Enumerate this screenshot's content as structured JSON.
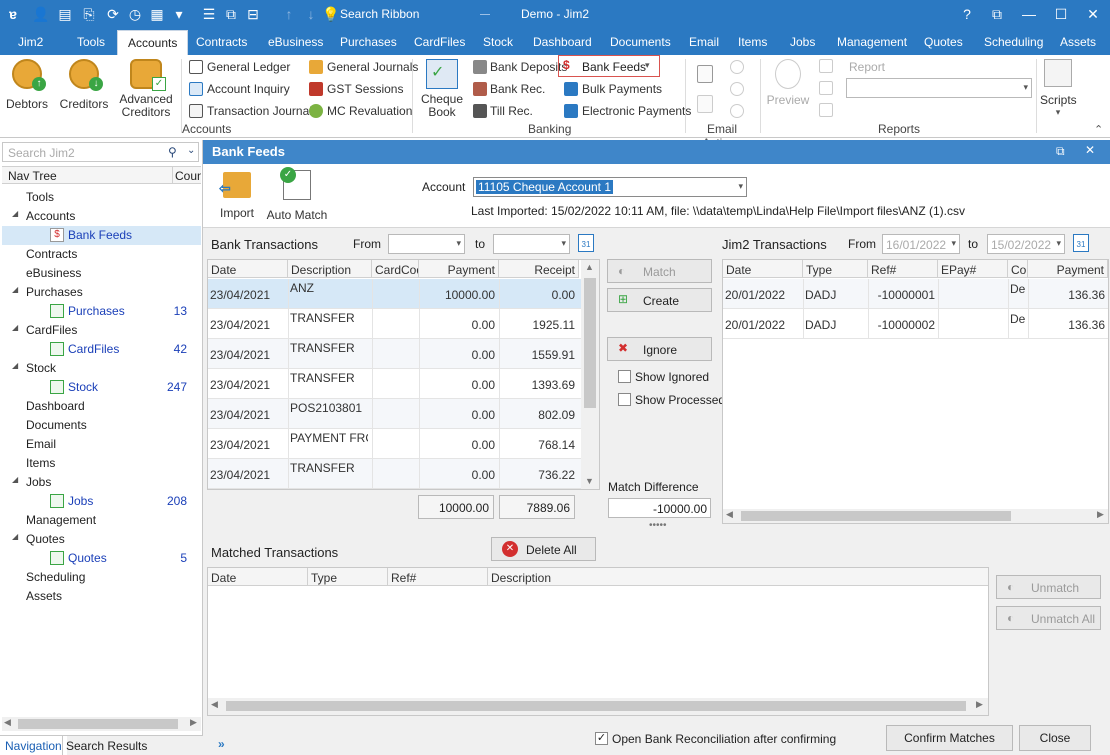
{
  "title": "Demo - Jim2",
  "quick_access": {
    "search_ribbon": "Search Ribbon"
  },
  "window_controls": {
    "help": "?",
    "restore": "⧉",
    "minimize": "—",
    "maximize": "☐",
    "close": "✕"
  },
  "menu_tabs": [
    "Jim2",
    "Tools",
    "Accounts",
    "Contracts",
    "eBusiness",
    "Purchases",
    "CardFiles",
    "Stock",
    "Dashboard",
    "Documents",
    "Email",
    "Items",
    "Jobs",
    "Management",
    "Quotes",
    "Scheduling",
    "Assets"
  ],
  "active_tab": "Accounts",
  "ribbon": {
    "debtors": "Debtors",
    "creditors": "Creditors",
    "advanced_creditors_1": "Advanced",
    "advanced_creditors_2": "Creditors",
    "general_ledger": "General Ledger",
    "account_inquiry": "Account Inquiry",
    "transaction_journal": "Transaction Journal",
    "general_journals": "General Journals",
    "gst_sessions": "GST Sessions",
    "mc_revaluation": "MC Revaluation",
    "accounts_group": "Accounts",
    "cheque_book_1": "Cheque",
    "cheque_book_2": "Book",
    "bank_deposits": "Bank Deposits",
    "bank_rec": "Bank Rec.",
    "till_rec": "Till Rec.",
    "bank_feeds": "Bank Feeds",
    "bulk_payments": "Bulk Payments",
    "electronic_payments": "Electronic Payments",
    "banking_group": "Banking",
    "email_actions_group": "Email Actions",
    "preview": "Preview",
    "report_label": "Report",
    "reports_group": "Reports",
    "scripts": "Scripts"
  },
  "nav": {
    "search_placeholder": "Search Jim2",
    "col_tree": "Nav Tree",
    "col_count": "Count",
    "items": [
      {
        "label": "Tools"
      },
      {
        "label": "Accounts"
      },
      {
        "label": "Bank Feeds",
        "sub": true
      },
      {
        "label": "Contracts"
      },
      {
        "label": "eBusiness"
      },
      {
        "label": "Purchases"
      },
      {
        "label": "Purchases",
        "sub": true,
        "count": "13"
      },
      {
        "label": "CardFiles"
      },
      {
        "label": "CardFiles",
        "sub": true,
        "count": "42"
      },
      {
        "label": "Stock"
      },
      {
        "label": "Stock",
        "sub": true,
        "count": "247"
      },
      {
        "label": "Dashboard"
      },
      {
        "label": "Documents"
      },
      {
        "label": "Email"
      },
      {
        "label": "Items"
      },
      {
        "label": "Jobs"
      },
      {
        "label": "Jobs",
        "sub": true,
        "count": "208"
      },
      {
        "label": "Management"
      },
      {
        "label": "Quotes"
      },
      {
        "label": "Quotes",
        "sub": true,
        "count": "5"
      },
      {
        "label": "Scheduling"
      },
      {
        "label": "Assets"
      }
    ],
    "tab_navigation": "Navigation",
    "tab_search_results": "Search Results"
  },
  "panel": {
    "title": "Bank Feeds",
    "import": "Import",
    "auto_match": "Auto Match",
    "account_label": "Account",
    "account_value": "11105 Cheque Account 1",
    "last_imported": "Last Imported: 15/02/2022 10:11 AM, file: \\\\data\\temp\\Linda\\Help File\\Import files\\ANZ (1).csv",
    "bank_transactions": "Bank Transactions",
    "from": "From",
    "to": "to",
    "bank_cols": [
      "Date",
      "Description",
      "CardCod",
      "Payment",
      "Receipt"
    ],
    "bank_rows": [
      [
        "23/04/2021",
        "ANZ",
        "",
        "10000.00",
        "0.00"
      ],
      [
        "23/04/2021",
        "TRANSFER",
        "",
        "0.00",
        "1925.11"
      ],
      [
        "23/04/2021",
        "TRANSFER",
        "",
        "0.00",
        "1559.91"
      ],
      [
        "23/04/2021",
        "TRANSFER",
        "",
        "0.00",
        "1393.69"
      ],
      [
        "23/04/2021",
        "POS2103801",
        "",
        "0.00",
        "802.09"
      ],
      [
        "23/04/2021",
        "PAYMENT FROM",
        "",
        "0.00",
        "768.14"
      ],
      [
        "23/04/2021",
        "TRANSFER",
        "",
        "0.00",
        "736.22"
      ]
    ],
    "bank_total_payment": "10000.00",
    "bank_total_receipt": "7889.06",
    "match": "Match",
    "create": "Create",
    "ignore": "Ignore",
    "show_ignored": "Show Ignored",
    "show_processed": "Show Processed",
    "match_difference_label": "Match Difference",
    "match_difference": "-10000.00",
    "jim2_transactions": "Jim2 Transactions",
    "jim2_from": "16/01/2022",
    "jim2_to": "15/02/2022",
    "jim2_cols": [
      "Date",
      "Type",
      "Ref#",
      "EPay#",
      "Cor",
      "Payment"
    ],
    "jim2_rows": [
      [
        "20/01/2022",
        "DADJ",
        "-10000001",
        "",
        "De",
        "136.36"
      ],
      [
        "20/01/2022",
        "DADJ",
        "-10000002",
        "",
        "De",
        "136.36"
      ]
    ],
    "matched_transactions": "Matched Transactions",
    "delete_all": "Delete All",
    "matched_cols": [
      "Date",
      "Type",
      "Ref#",
      "Description"
    ],
    "unmatch": "Unmatch",
    "unmatch_all": "Unmatch All",
    "open_bank_rec": "Open Bank Reconciliation after confirming",
    "confirm_matches": "Confirm Matches",
    "close": "Close"
  },
  "colors": {
    "title_blue": "#2b79c2",
    "panel_blue": "#3f86c9",
    "selection": "#d6e8f7",
    "red_x": "#d32f2f"
  }
}
